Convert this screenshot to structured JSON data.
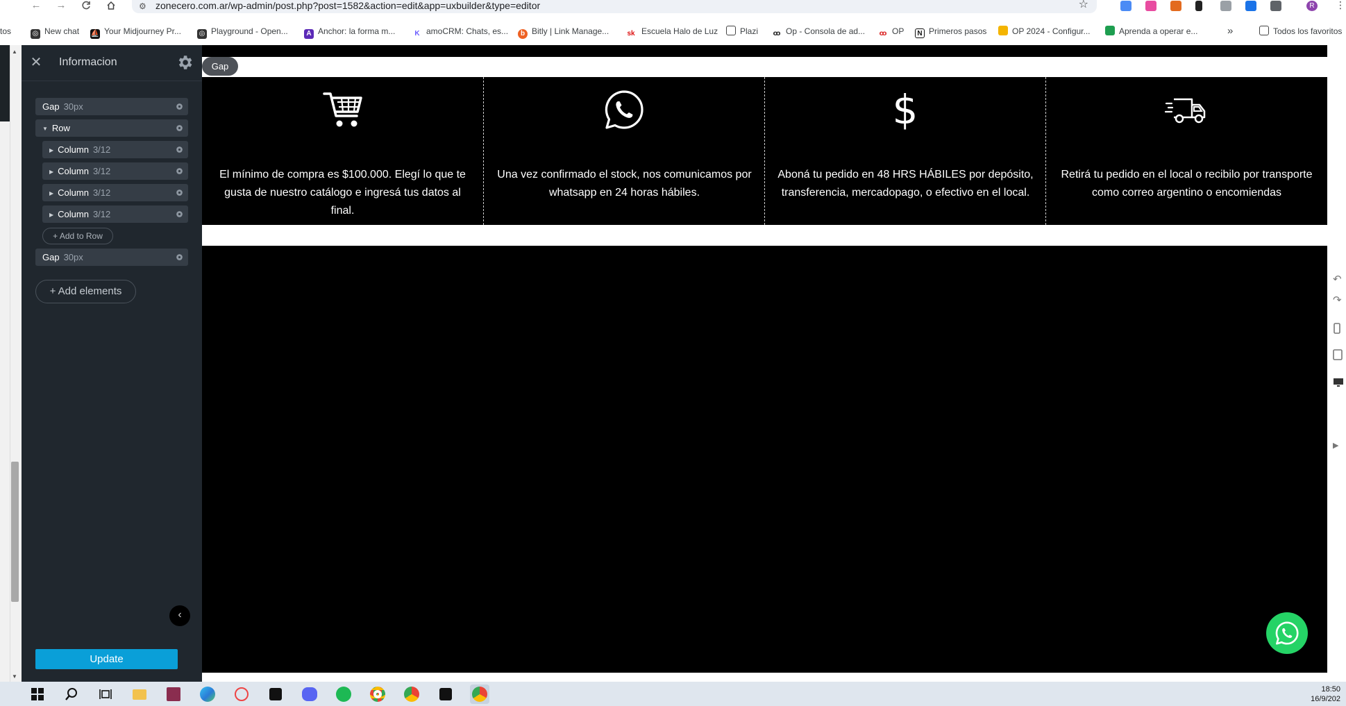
{
  "browser": {
    "url": "zonecero.com.ar/wp-admin/post.php?post=1582&action=edit&app=uxbuilder&type=editor",
    "bookmarks": [
      "tos",
      "New chat",
      "Your Midjourney Pr...",
      "Playground - Open...",
      "Anchor: la forma m...",
      "amoCRM: Chats, es...",
      "Bitly | Link Manage...",
      "Escuela Halo de Luz",
      "Plazi",
      "Op - Consola de ad...",
      "OP",
      "Primeros pasos",
      "OP 2024 - Configur...",
      "Aprenda a operar e...",
      "»",
      "Todos los favoritos"
    ],
    "bookmark_icon_letters": {
      "midjourney": "⛵",
      "anchor": "A",
      "sk": "sk",
      "notion": "N",
      "op": "ꝏ"
    },
    "profile_initial": "R"
  },
  "sidebar": {
    "title": "Informacion",
    "tree": [
      {
        "label": "Gap",
        "sub": "30px"
      },
      {
        "label": "Row",
        "sub": ""
      },
      {
        "label": "Column",
        "sub": "3/12"
      },
      {
        "label": "Column",
        "sub": "3/12"
      },
      {
        "label": "Column",
        "sub": "3/12"
      },
      {
        "label": "Column",
        "sub": "3/12"
      },
      {
        "label": "Gap",
        "sub": "30px"
      }
    ],
    "add_to_row": "+ Add to Row",
    "add_elements": "+ Add elements",
    "update": "Update"
  },
  "canvas": {
    "gap_badge": "Gap",
    "columns": [
      {
        "icon": "cart-icon",
        "text": "El mínimo de compra es $100.000. Elegí lo que te gusta de nuestro catálogo e ingresá tus datos al final."
      },
      {
        "icon": "whatsapp-icon",
        "text": "Una vez confirmado el stock, nos comunicamos por whatsapp en 24 horas hábiles."
      },
      {
        "icon": "dollar-icon",
        "text": "Aboná tu pedido en 48 HRS HÁBILES por depósito, transferencia, mercadopago, o efectivo en el local."
      },
      {
        "icon": "truck-icon",
        "text": "Retirá tu pedido en el local o recibilo por transporte como correo argentino o encomiendas"
      }
    ],
    "dollar_glyph": "$"
  },
  "taskbar": {
    "time": "18:50",
    "date": "16/9/202"
  },
  "colors": {
    "sidebar_bg": "#20272e",
    "update_button": "#0a9fd8",
    "whatsapp_green": "#25d366",
    "canvas_bg": "#000000"
  }
}
